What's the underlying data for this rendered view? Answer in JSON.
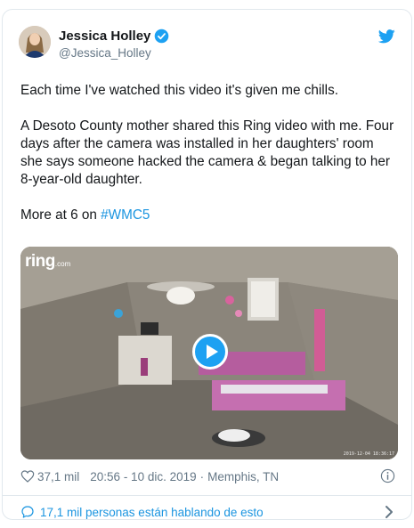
{
  "tweet": {
    "author_name": "Jessica Holley",
    "author_handle": "@Jessica_Holley",
    "paragraph_1": "Each time I've watched this video it's given me chills.",
    "paragraph_2": "A Desoto County mother shared this Ring video with me. Four days after the camera was installed in her daughters' room she says someone hacked the camera & began talking to her 8-year-old daughter.",
    "paragraph_3_prefix": "More at 6 on ",
    "hashtag": "#WMC5",
    "media": {
      "watermark": "ring",
      "watermark_suffix": ".com",
      "overlay_timestamp": "2019-12-04 18:36:17"
    },
    "likes": "37,1 mil",
    "time": "20:56 - 10 dic. 2019",
    "separator": "·",
    "location": "Memphis, TN",
    "conversation": "17,1 mil personas están hablando de esto"
  },
  "colors": {
    "accent": "#1da1f2",
    "link": "#1b95e0",
    "muted": "#657786",
    "border": "#e1e8ed"
  },
  "icons": [
    "verified-badge-icon",
    "twitter-bird-icon",
    "play-icon",
    "heart-icon",
    "info-icon",
    "speech-bubble-icon",
    "chevron-right-icon"
  ]
}
